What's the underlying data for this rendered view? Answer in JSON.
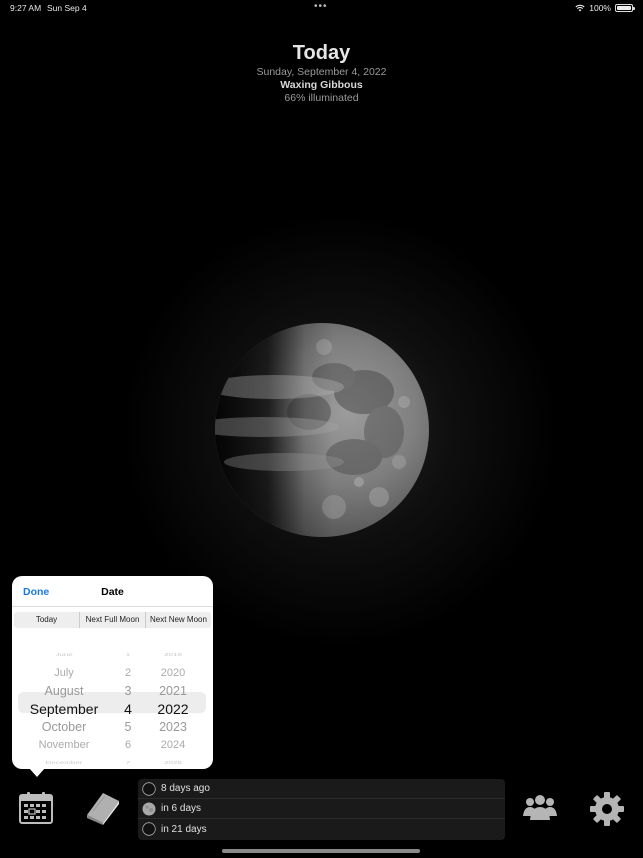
{
  "status_bar": {
    "time": "9:27 AM",
    "date": "Sun Sep 4",
    "dots": "•••",
    "battery": "100%"
  },
  "header": {
    "title": "Today",
    "date": "Sunday, September 4, 2022",
    "phase": "Waxing Gibbous",
    "illumination": "66% illuminated"
  },
  "moon": {
    "illumination_fraction": 0.66
  },
  "date_popover": {
    "done_label": "Done",
    "title": "Date",
    "segments": [
      "Today",
      "Next Full Moon",
      "Next New Moon"
    ],
    "picker": {
      "months": [
        "June",
        "July",
        "August",
        "September",
        "October",
        "November",
        "December"
      ],
      "days": [
        "1",
        "2",
        "3",
        "4",
        "5",
        "6",
        "7"
      ],
      "years": [
        "2019",
        "2020",
        "2021",
        "2022",
        "2023",
        "2024",
        "2025"
      ],
      "selected": {
        "month": "September",
        "day": "4",
        "year": "2022"
      }
    }
  },
  "upcoming": [
    {
      "icon": "new-moon-icon",
      "label": "8 days ago"
    },
    {
      "icon": "full-moon-icon",
      "label": "in 6 days"
    },
    {
      "icon": "new-moon-icon",
      "label": "in 21 days"
    }
  ],
  "toolbar": {
    "calendar": "calendar-icon",
    "book": "book-icon",
    "people": "people-icon",
    "settings": "gear-icon"
  }
}
